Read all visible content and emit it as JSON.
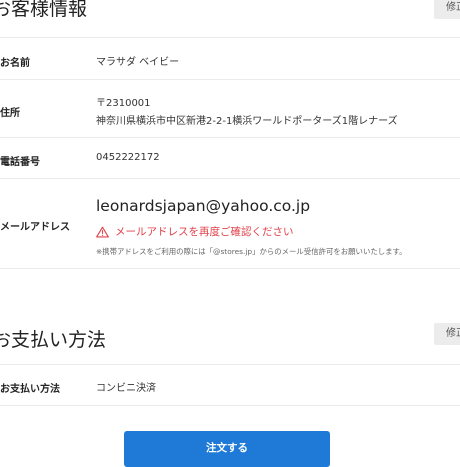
{
  "customer_info": {
    "title": "お客様情報",
    "edit_label": "修正",
    "rows": [
      {
        "label": "お名前",
        "value": "マラサダ ベイビー"
      },
      {
        "label": "住所",
        "postal": "〒2310001",
        "address": "神奈川県横浜市中区新港2-2-1横浜ワールドポーターズ1階レナーズ"
      },
      {
        "label": "電話番号",
        "value": "0452222172"
      },
      {
        "label": "メールアドレス",
        "value": "leonardsjapan@yahoo.co.jp",
        "warning": "メールアドレスを再度ご確認ください",
        "note": "※携帯アドレスをご利用の際には「@stores.jp」からのメール受信許可をお願いいたします。"
      }
    ]
  },
  "payment": {
    "title": "お支払い方法",
    "edit_label": "修正",
    "label": "お支払い方法",
    "value": "コンビニ決済"
  },
  "submit_label": "注文する",
  "colors": {
    "warning": "#e0424a",
    "primary_button": "#1f7ad7",
    "edit_button_bg": "#ececec",
    "divider": "#ebebeb"
  }
}
